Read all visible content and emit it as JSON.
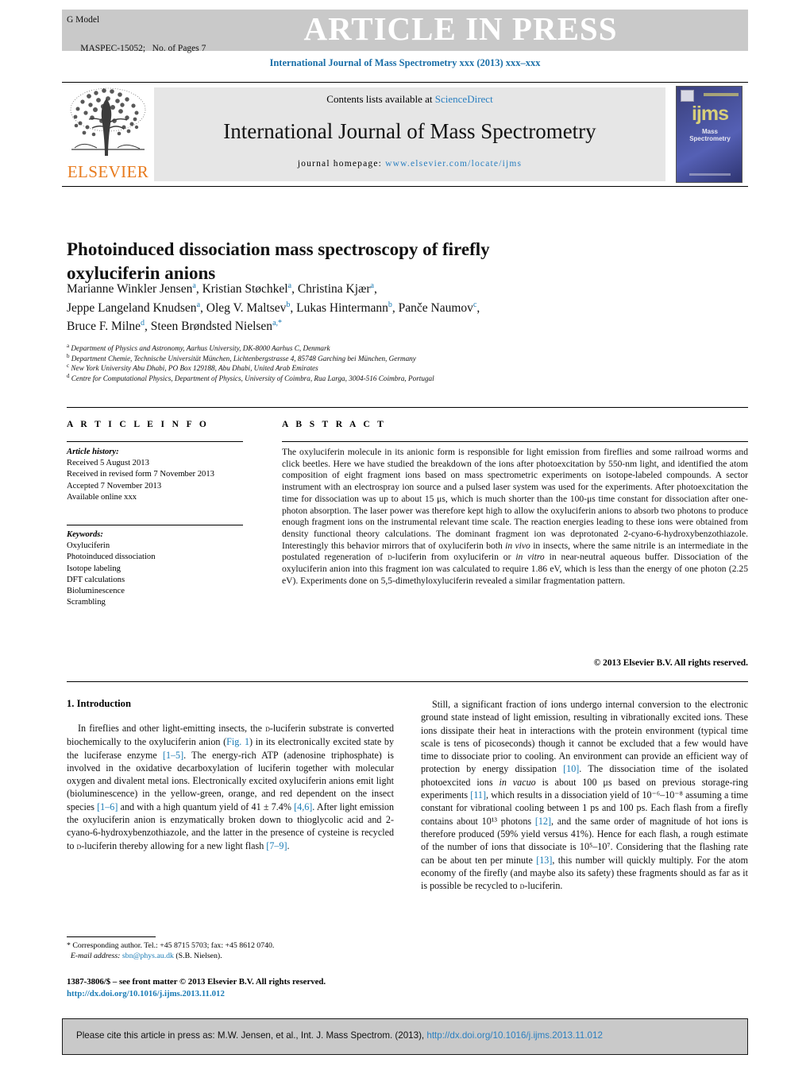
{
  "banner": {
    "g_model": "G Model",
    "manuscript_id": "MASPEC-15052;",
    "pages": "No. of Pages 7",
    "article_in_press": "ARTICLE IN PRESS"
  },
  "journal_ref": "International Journal of Mass Spectrometry xxx (2013) xxx–xxx",
  "masthead": {
    "contents_prefix": "Contents lists available at ",
    "sciencedirect": "ScienceDirect",
    "journal_title": "International Journal of Mass Spectrometry",
    "homepage_label": "journal homepage:",
    "homepage_url": "www.elsevier.com/locate/ijms",
    "elsevier_word": "ELSEVIER",
    "cover_title": "ijms",
    "cover_subtitle": "Mass Spectrometry"
  },
  "article": {
    "title": "Photoinduced dissociation mass spectroscopy of firefly oxyluciferin anions",
    "authors_line1": "Marianne Winkler Jensen",
    "authors": [
      {
        "name": "Marianne Winkler Jensen",
        "sup": "a"
      },
      {
        "name": "Kristian Støchkel",
        "sup": "a"
      },
      {
        "name": "Christina Kjær",
        "sup": "a"
      },
      {
        "name": "Jeppe Langeland Knudsen",
        "sup": "a"
      },
      {
        "name": "Oleg V. Maltsev",
        "sup": "b"
      },
      {
        "name": "Lukas Hintermann",
        "sup": "b"
      },
      {
        "name": "Panče Naumov",
        "sup": "c"
      },
      {
        "name": "Bruce F. Milne",
        "sup": "d"
      },
      {
        "name": "Steen Brøndsted Nielsen",
        "sup": "a,*"
      }
    ],
    "affiliations": [
      {
        "marker": "a",
        "text": "Department of Physics and Astronomy, Aarhus University, DK-8000 Aarhus C, Denmark"
      },
      {
        "marker": "b",
        "text": "Department Chemie, Technische Universität München, Lichtenbergstrasse 4, 85748 Garching bei München, Germany"
      },
      {
        "marker": "c",
        "text": "New York University Abu Dhabi, PO Box 129188, Abu Dhabi, United Arab Emirates"
      },
      {
        "marker": "d",
        "text": "Centre for Computational Physics, Department of Physics, University of Coimbra, Rua Larga, 3004-516 Coimbra, Portugal"
      }
    ]
  },
  "article_info": {
    "heading": "A R T I C L E    I N F O",
    "history_label": "Article history:",
    "history": [
      "Received 5 August 2013",
      "Received in revised form 7 November 2013",
      "Accepted 7 November 2013",
      "Available online xxx"
    ],
    "keywords_label": "Keywords:",
    "keywords": [
      "Oxyluciferin",
      "Photoinduced dissociation",
      "Isotope labeling",
      "DFT calculations",
      "Bioluminescence",
      "Scrambling"
    ]
  },
  "abstract": {
    "heading": "A B S T R A C T",
    "text_part1": "The oxyluciferin molecule in its anionic form is responsible for light emission from fireflies and some railroad worms and click beetles. Here we have studied the breakdown of the ions after photoexcitation by 550-nm light, and identified the atom composition of eight fragment ions based on mass spectrometric experiments on isotope-labeled compounds. A sector instrument with an electrospray ion source and a pulsed laser system was used for the experiments. After photoexcitation the time for dissociation was up to about 15 μs, which is much shorter than the 100-μs time constant for dissociation after one-photon absorption. The laser power was therefore kept high to allow the oxyluciferin anions to absorb two photons to produce enough fragment ions on the instrumental relevant time scale. The reaction energies leading to these ions were obtained from density functional theory calculations. The dominant fragment ion was deprotonated 2-cyano-6-hydroxybenzothiazole. Interestingly this behavior mirrors that of oxyluciferin both ",
    "italic1": "in vivo",
    "text_part2": " in insects, where the same nitrile is an intermediate in the postulated regeneration of ",
    "smallcaps1": "d",
    "text_part3": "-luciferin from oxyluciferin or ",
    "italic2": "in vitro",
    "text_part4": " in near-neutral aqueous buffer. Dissociation of the oxyluciferin anion into this fragment ion was calculated to require 1.86 eV, which is less than the energy of one photon (2.25 eV). Experiments done on 5,5-dimethyloxyluciferin revealed a similar fragmentation pattern.",
    "copyright": "© 2013 Elsevier B.V. All rights reserved."
  },
  "body": {
    "section_heading": "1. Introduction",
    "left_column": {
      "t1": "In fireflies and other light-emitting insects, the ",
      "sc1": "d",
      "t2": "-luciferin substrate is converted biochemically to the oxyluciferin anion (",
      "link1": "Fig. 1",
      "t3": ") in its electronically excited state by the luciferase enzyme ",
      "link2": "[1–5]",
      "t4": ". The energy-rich ATP (adenosine triphosphate) is involved in the oxidative decarboxylation of luciferin together with molecular oxygen and divalent metal ions. Electronically excited oxyluciferin anions emit light (bioluminescence) in the yellow-green, orange, and red dependent on the insect species ",
      "link3": "[1–6]",
      "t5": " and with a high quantum yield of 41 ± 7.4% ",
      "link4": "[4,6]",
      "t6": ". After light emission the oxyluciferin anion is enzymatically broken down to thioglycolic acid and 2-cyano-6-hydroxybenzothiazole, and the latter in the presence of cysteine is recycled to ",
      "sc2": "d",
      "t7": "-luciferin thereby allowing for a new light flash ",
      "link5": "[7–9]",
      "t8": "."
    },
    "right_column": {
      "t1": "Still, a significant fraction of ions undergo internal conversion to the electronic ground state instead of light emission, resulting in vibrationally excited ions. These ions dissipate their heat in interactions with the protein environment (typical time scale is tens of picoseconds) though it cannot be excluded that a few would have time to dissociate prior to cooling. An environment can provide an efficient way of protection by energy dissipation ",
      "link1": "[10]",
      "t2": ". The dissociation time of the isolated photoexcited ions ",
      "it1": "in vacuo",
      "t3": " is about 100 μs based on previous storage-ring experiments ",
      "link2": "[11]",
      "t4": ", which results in a dissociation yield of 10⁻⁶–10⁻⁸ assuming a time constant for vibrational cooling between 1 ps and 100 ps. Each flash from a firefly contains about 10¹³ photons ",
      "link3": "[12]",
      "t5": ", and the same order of magnitude of hot ions is therefore produced (59% yield versus 41%). Hence for each flash, a rough estimate of the number of ions that dissociate is 10⁵–10⁷. Considering that the flashing rate can be about ten per minute ",
      "link4": "[13]",
      "t6": ", this number will quickly multiply. For the atom economy of the firefly (and maybe also its safety) these fragments should as far as it is possible be recycled to ",
      "sc1": "d",
      "t7": "-luciferin."
    }
  },
  "footnote": {
    "corresponding": "* Corresponding author. Tel.: +45 8715 5703; fax: +45 8612 0740.",
    "email_label": "E-mail address:",
    "email": "sbn@phys.au.dk",
    "email_owner": "(S.B. Nielsen).",
    "frontmatter": "1387-3806/$ – see front matter © 2013 Elsevier B.V. All rights reserved.",
    "doi": "http://dx.doi.org/10.1016/j.ijms.2013.11.012"
  },
  "cite_box": {
    "text": "Please cite this article in press as: M.W. Jensen, et al., Int. J. Mass Spectrom. (2013), ",
    "doi": "http://dx.doi.org/10.1016/j.ijms.2013.11.012"
  },
  "colors": {
    "link": "#1a7bb5",
    "banner_gray": "#c9c9c9",
    "elsevier_orange": "#e87b1e"
  }
}
